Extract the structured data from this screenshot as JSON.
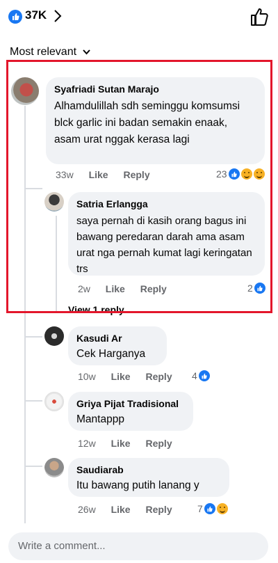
{
  "header": {
    "reaction_count": "37K"
  },
  "sort": {
    "label": "Most relevant"
  },
  "comments": [
    {
      "author": "Syafriadi Sutan Marajo",
      "text": "Alhamdulillah sdh seminggu komsumsi blck garlic ini badan semakin enaak, asam urat nggak kerasa lagi",
      "time": "33w",
      "like": "Like",
      "reply": "Reply",
      "reactions": "23",
      "reply_item": {
        "author": "Satria Erlangga",
        "text": "saya pernah di kasih orang bagus ini bawang peredaran darah ama asam urat nga pernah kumat lagi keringatan trs",
        "time": "2w",
        "like": "Like",
        "reply": "Reply",
        "reactions": "2"
      },
      "view_replies": "View 1 reply"
    },
    {
      "author": "Kasudi Ar",
      "text": "Cek Harganya",
      "time": "10w",
      "like": "Like",
      "reply": "Reply",
      "reactions": "4"
    },
    {
      "author": "Griya Pijat Tradisional",
      "text": "Mantappp",
      "time": "12w",
      "like": "Like",
      "reply": "Reply",
      "reactions": ""
    },
    {
      "author": "Saudiarab",
      "text": "Itu bawang putih lanang y",
      "time": "26w",
      "like": "Like",
      "reply": "Reply",
      "reactions": "7"
    }
  ],
  "composer": {
    "placeholder": "Write a comment..."
  },
  "colors": {
    "accent": "#1877f2",
    "highlight": "#e3162b",
    "bubble": "#f0f2f5",
    "meta": "#65676b"
  },
  "icons": [
    "like-reaction-icon",
    "chevron-right-icon",
    "thumbs-up-outline-icon",
    "chevron-down-icon",
    "haha-reaction-icon",
    "sad-reaction-icon"
  ]
}
